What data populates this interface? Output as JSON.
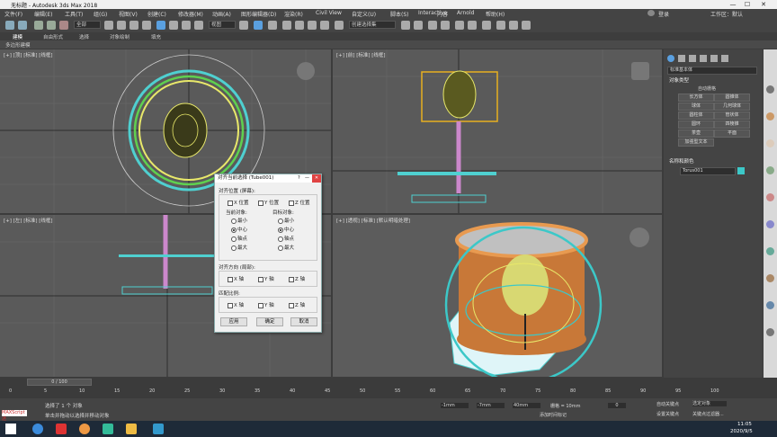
{
  "window": {
    "title": "无标题 - Autodesk 3ds Max 2018",
    "min": "—",
    "max": "☐",
    "close": "✕"
  },
  "menu": [
    "文件(F)",
    "编辑(E)",
    "工具(T)",
    "组(G)",
    "视图(V)",
    "创建(C)",
    "修改器(M)",
    "动画(A)",
    "图形编辑器(D)",
    "渲染(R)",
    "Civil View",
    "自定义(U)",
    "脚本(S)",
    "Interactive",
    "内容",
    "Arnold",
    "帮助(H)"
  ],
  "login": "登录",
  "workspace": "工作区：默认",
  "toolbar": {
    "selection_filter": "全部",
    "view_dropdown": "视图",
    "named_selection": "创建选择集"
  },
  "ribbon": {
    "tabs": [
      "建模",
      "自由形式",
      "选择",
      "对象绘制",
      "填充"
    ],
    "sub": "多边形建模"
  },
  "viewports": {
    "top": "[+] [顶] [标准] [线框]",
    "front": "[+] [前] [标准] [线框]",
    "left": "[+] [左] [标准] [线框]",
    "perspective": "[+] [透视] [标准] [默认明暗处理]"
  },
  "cmd": {
    "dropdown": "标准基本体",
    "section_type": "对象类型",
    "autogrid": "自动栅格",
    "buttons": [
      "长方体",
      "圆锥体",
      "球体",
      "几何球体",
      "圆柱体",
      "管状体",
      "圆环",
      "四棱锥",
      "茶壶",
      "平面",
      "加强型文本",
      ""
    ],
    "section_name": "名称和颜色",
    "name": "Torus001"
  },
  "dialog": {
    "title": "对齐当前选择 (Tube001)",
    "help": "?",
    "min": "—",
    "close": "✕",
    "group_pos": "对齐位置 (屏幕):",
    "x_pos": "X 位置",
    "y_pos": "Y 位置",
    "z_pos": "Z 位置",
    "current": "当前对象:",
    "target": "目标对象:",
    "opts": [
      "最小",
      "中心",
      "轴点",
      "最大"
    ],
    "group_orient": "对齐方向 (局部):",
    "group_scale": "匹配比例:",
    "axes": [
      "X 轴",
      "Y 轴",
      "Z 轴"
    ],
    "apply": "应用",
    "ok": "确定",
    "cancel": "取消"
  },
  "timeline": {
    "frame": "0 / 100",
    "ticks": [
      "0",
      "5",
      "10",
      "15",
      "20",
      "25",
      "30",
      "35",
      "40",
      "45",
      "50",
      "55",
      "60",
      "65",
      "70",
      "75",
      "80",
      "85",
      "90",
      "95",
      "100"
    ]
  },
  "status": {
    "maxscript": "MAXScript 迷",
    "line1": "选择了 1 个 对象",
    "line2": "单击并拖动以选择并移动对象",
    "x": "-1mm",
    "y": "-7mm",
    "z": "40mm",
    "grid": "栅格 = 10mm",
    "addtime": "添加时间标记",
    "autokey": "自动关键点",
    "selected": "选定对象",
    "setkey": "设置关键点",
    "keyfilter": "关键点过滤器...",
    "frame": "0"
  },
  "taskbar": {
    "time": "11:05",
    "date": "2020/9/5"
  }
}
